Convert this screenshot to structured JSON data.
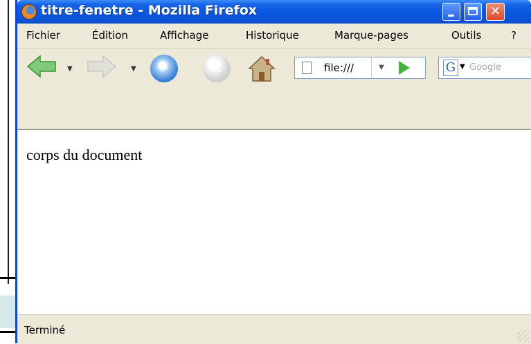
{
  "window": {
    "title": "titre-fenetre - Mozilla Firefox",
    "controls": {
      "minimize": "minimize",
      "maximize": "maximize",
      "close": "close"
    }
  },
  "menubar": {
    "items": [
      {
        "label": "Fichier"
      },
      {
        "label": "Édition"
      },
      {
        "label": "Affichage"
      },
      {
        "label": "Historique"
      },
      {
        "label": "Marque-pages"
      },
      {
        "label": "Outils"
      },
      {
        "label": "?"
      }
    ]
  },
  "toolbar": {
    "back_icon": "back-arrow-icon",
    "forward_icon": "forward-arrow-icon",
    "reload_icon": "reload-icon",
    "stop_icon": "stop-icon",
    "home_icon": "home-icon",
    "stop_glyph": "×",
    "dropdown_glyph": "▼",
    "url": "file:///",
    "search_engine_glyph": "G",
    "search_placeholder": "Google"
  },
  "content": {
    "text": "corps du document"
  },
  "statusbar": {
    "status": "Terminé"
  },
  "colors": {
    "titlebar": "#0a55df",
    "chrome": "#ece9d8",
    "close_button": "#d94a2a",
    "go_arrow": "#47b23b"
  }
}
